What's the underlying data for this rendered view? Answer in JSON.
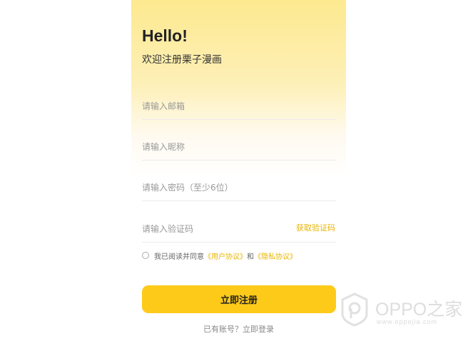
{
  "header": {
    "title": "Hello!",
    "subtitle": "欢迎注册栗子漫画"
  },
  "form": {
    "email_placeholder": "请输入邮箱",
    "nickname_placeholder": "请输入昵称",
    "password_placeholder": "请输入密码（至少6位）",
    "code_placeholder": "请输入验证码",
    "get_code_label": "获取验证码"
  },
  "agreement": {
    "prefix": "我已阅读并同意",
    "user_agreement": "《用户协议》",
    "and": "和",
    "privacy_agreement": "《隐私协议》"
  },
  "actions": {
    "register_label": "立即注册",
    "has_account": "已有账号？",
    "login_label": "立即登录"
  },
  "watermark": {
    "brand": "OPPO之家",
    "url": "www.oppojia.com",
    "logo_icon": "oppo-logo-icon"
  },
  "colors": {
    "accent": "#fdca1a",
    "link": "#e8b500",
    "gradient_top": "#fde98f"
  }
}
